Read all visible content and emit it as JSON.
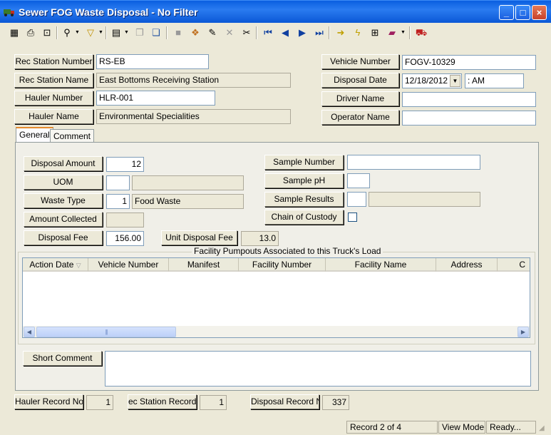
{
  "window": {
    "title": "Sewer FOG Waste Disposal - No Filter",
    "minimize": "_",
    "maximize": "□",
    "close": "×"
  },
  "toolbar": {
    "icons": [
      "grid-view-icon",
      "print-icon",
      "print-preview-icon",
      "binoculars-icon",
      "filter-icon",
      "document-icon",
      "copy-icon",
      "paste-icon",
      "delete-record-icon",
      "notes-icon",
      "pencil-icon",
      "cancel-icon",
      "scissors-icon",
      "first-record-icon",
      "previous-record-icon",
      "next-record-icon",
      "last-record-icon",
      "goto-icon",
      "lightning-icon",
      "map-icon",
      "book-icon",
      "exit-icon"
    ]
  },
  "header": {
    "rec_station_number_label": "Rec Station Number",
    "rec_station_number": "RS-EB",
    "rec_station_name_label": "Rec Station Name",
    "rec_station_name": "East Bottoms Receiving Station",
    "hauler_number_label": "Hauler Number",
    "hauler_number": "HLR-001",
    "hauler_name_label": "Hauler Name",
    "hauler_name": "Environmental Specialities",
    "vehicle_number_label": "Vehicle Number",
    "vehicle_number": "FOGV-10329",
    "disposal_date_label": "Disposal Date",
    "disposal_date": "12/18/2012",
    "disposal_time": " :  AM",
    "driver_name_label": "Driver Name",
    "driver_name": "",
    "operator_name_label": "Operator Name",
    "operator_name": ""
  },
  "tabs": {
    "general": "General",
    "comment": "Comment"
  },
  "general": {
    "disposal_amount_label": "Disposal Amount",
    "disposal_amount": "12",
    "uom_label": "UOM",
    "uom": "",
    "uom_desc": "",
    "waste_type_label": "Waste Type",
    "waste_type_code": "1",
    "waste_type_desc": "Food Waste",
    "amount_collected_label": "Amount Collected",
    "amount_collected": "",
    "disposal_fee_label": "Disposal Fee",
    "disposal_fee": "156.00",
    "unit_disposal_fee_label": "Unit Disposal Fee",
    "unit_disposal_fee": "13.0",
    "sample_number_label": "Sample Number",
    "sample_number": "",
    "sample_ph_label": "Sample pH",
    "sample_ph": "",
    "sample_results_label": "Sample Results",
    "sample_results_code": "",
    "sample_results_desc": "",
    "chain_of_custody_label": "Chain of Custody",
    "chain_of_custody_checked": false
  },
  "pumpouts": {
    "title": "Facility Pumpouts Associated to this Truck's Load",
    "columns": [
      "Action Date",
      "Vehicle Number",
      "Manifest",
      "Facility Number",
      "Facility Name",
      "Address",
      "C"
    ],
    "rows": []
  },
  "short_comment": {
    "label": "Short Comment",
    "value": ""
  },
  "footer": {
    "hauler_record_label": "Hauler Record No",
    "hauler_record": "1",
    "rec_station_record_label": "ec Station Record N",
    "rec_station_record": "1",
    "disposal_record_label": "Disposal Record No",
    "disposal_record": "337"
  },
  "statusbar": {
    "record": "Record 2 of 4",
    "mode": "View Mode",
    "state": "Ready..."
  }
}
